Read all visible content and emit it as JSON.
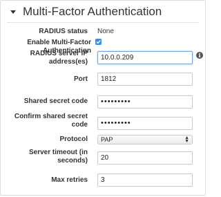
{
  "section": {
    "title": "Multi-Factor Authentication"
  },
  "form": {
    "radius_status": {
      "label": "RADIUS status",
      "value": "None"
    },
    "enable_mfa": {
      "label": "Enable Multi-Factor Authentication",
      "checked": true
    },
    "server_ip": {
      "label_line1": "RADIUS server IP",
      "label_line2": "address(es)",
      "value": "10.0.0.209"
    },
    "port": {
      "label": "Port",
      "value": "1812"
    },
    "shared_secret": {
      "label": "Shared secret code",
      "value": "•••••••••"
    },
    "confirm_secret": {
      "label_line1": "Confirm shared secret",
      "label_line2": "code",
      "value": "•••••••••"
    },
    "protocol": {
      "label": "Protocol",
      "selected": "PAP"
    },
    "server_timeout": {
      "label_line1": "Server timeout (in",
      "label_line2": "seconds)",
      "value": "20"
    },
    "max_retries": {
      "label": "Max retries",
      "value": "3"
    }
  },
  "icons": {
    "caret": "caret-down-icon",
    "info": "info-icon",
    "check": "check-icon",
    "select_arrows": "select-arrows-icon"
  },
  "colors": {
    "accent": "#3b8ede",
    "focus_border": "#6aa5e0"
  }
}
